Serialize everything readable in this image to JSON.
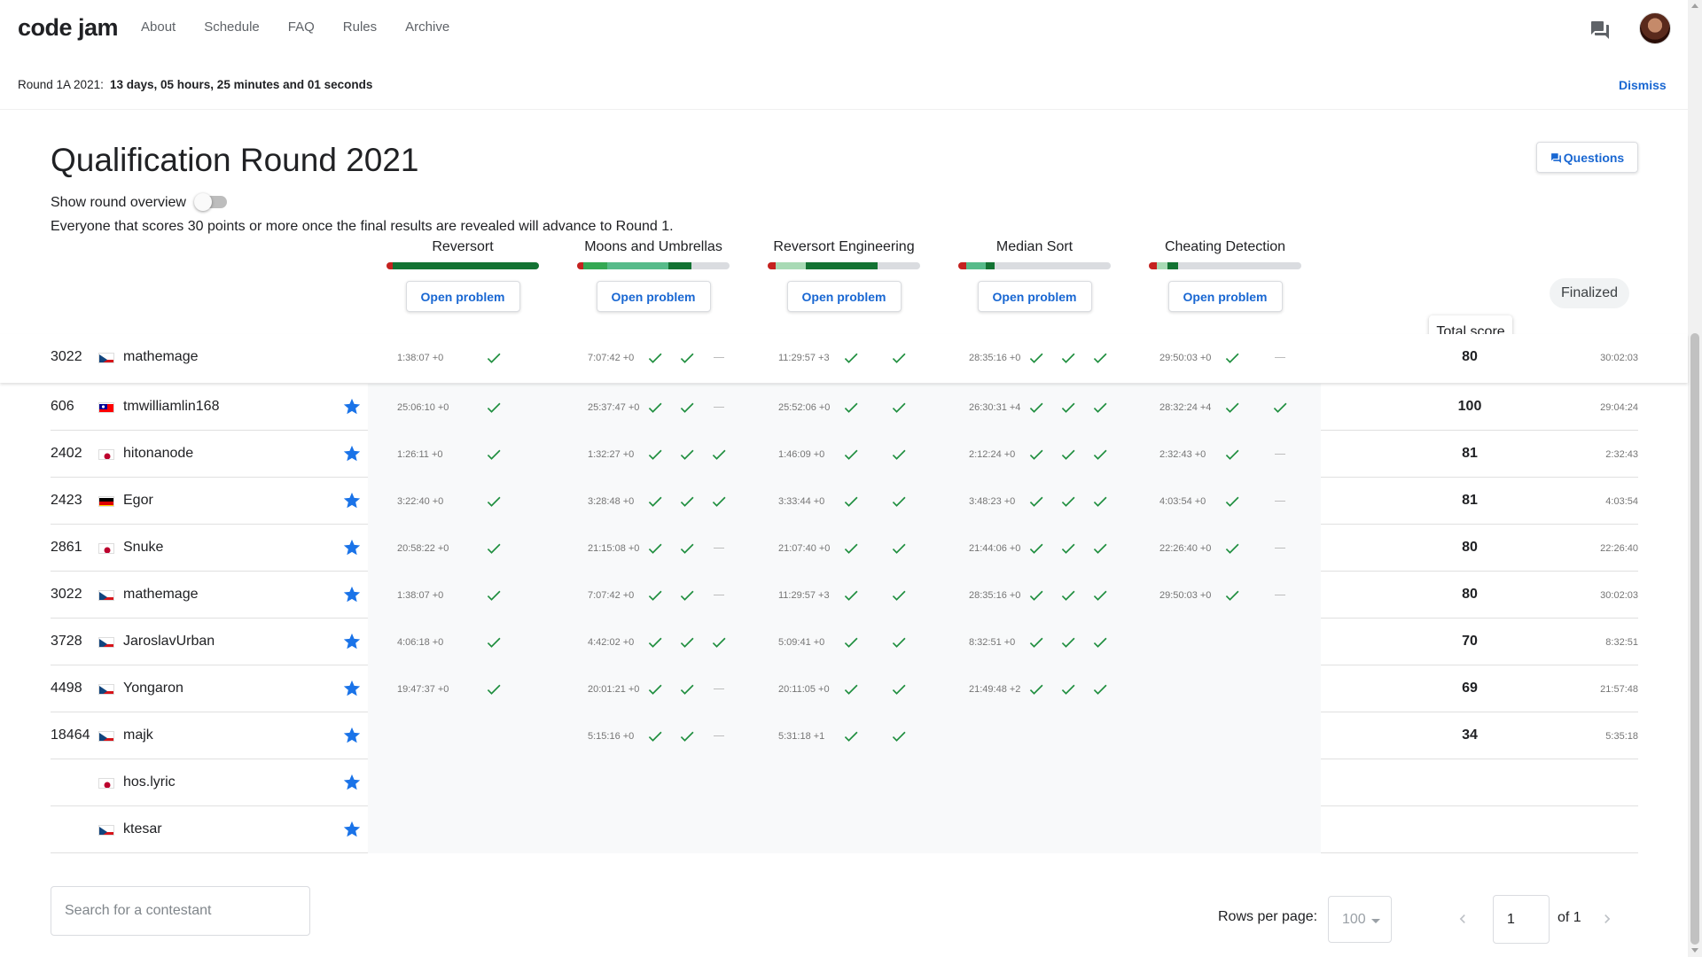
{
  "nav": {
    "logo": "code jam",
    "links": [
      "About",
      "Schedule",
      "FAQ",
      "Rules",
      "Archive"
    ]
  },
  "banner": {
    "label": "Round 1A 2021:",
    "countdown": "13 days, 05 hours, 25 minutes and 01 seconds",
    "dismiss": "Dismiss"
  },
  "page": {
    "title": "Qualification Round 2021",
    "questions_label": "Questions",
    "toggle_label": "Show round overview",
    "note": "Everyone that scores 30 points or more once the final results are revealed will advance to Round 1.",
    "finalized": "Finalized",
    "total_score_tooltip": "Total score"
  },
  "problems": [
    {
      "name": "Reversort",
      "button": "Open problem",
      "progress": [
        {
          "color": "#c5221f",
          "pct": 4
        },
        {
          "color": "#137333",
          "pct": 96
        }
      ]
    },
    {
      "name": "Moons and Umbrellas",
      "button": "Open problem",
      "progress": [
        {
          "color": "#c5221f",
          "pct": 4
        },
        {
          "color": "#34a853",
          "pct": 16
        },
        {
          "color": "#57bb8a",
          "pct": 40
        },
        {
          "color": "#137333",
          "pct": 15
        }
      ]
    },
    {
      "name": "Reversort Engineering",
      "button": "Open problem",
      "progress": [
        {
          "color": "#c5221f",
          "pct": 5
        },
        {
          "color": "#a8dab5",
          "pct": 20
        },
        {
          "color": "#137333",
          "pct": 47
        }
      ]
    },
    {
      "name": "Median Sort",
      "button": "Open problem",
      "progress": [
        {
          "color": "#c5221f",
          "pct": 5
        },
        {
          "color": "#57bb8a",
          "pct": 13
        },
        {
          "color": "#137333",
          "pct": 6
        }
      ]
    },
    {
      "name": "Cheating Detection",
      "button": "Open problem",
      "progress": [
        {
          "color": "#c5221f",
          "pct": 5
        },
        {
          "color": "#a8dab5",
          "pct": 7
        },
        {
          "color": "#137333",
          "pct": 7
        }
      ]
    }
  ],
  "sticky_row": {
    "rank": "3022",
    "flag": "cz",
    "name": "mathemage",
    "cells": [
      {
        "time": "1:38:07 +0",
        "marks": [
          "check"
        ]
      },
      {
        "time": "7:07:42 +0",
        "marks": [
          "check",
          "check",
          "dash"
        ]
      },
      {
        "time": "11:29:57 +3",
        "marks": [
          "check",
          "check"
        ]
      },
      {
        "time": "28:35:16 +0",
        "marks": [
          "check",
          "check",
          "check"
        ]
      },
      {
        "time": "29:50:03 +0",
        "marks": [
          "check",
          "dash"
        ]
      }
    ],
    "score": "80",
    "total_time": "30:02:03"
  },
  "rows": [
    {
      "rank": "606",
      "flag": "tw",
      "name": "tmwilliamlin168",
      "cells": [
        {
          "time": "25:06:10 +0",
          "marks": [
            "check"
          ]
        },
        {
          "time": "25:37:47 +0",
          "marks": [
            "check",
            "check",
            "dash"
          ]
        },
        {
          "time": "25:52:06 +0",
          "marks": [
            "check",
            "check"
          ]
        },
        {
          "time": "26:30:31 +4",
          "marks": [
            "check",
            "check",
            "check"
          ]
        },
        {
          "time": "28:32:24 +4",
          "marks": [
            "check",
            "check"
          ]
        }
      ],
      "score": "100",
      "total_time": "29:04:24"
    },
    {
      "rank": "2402",
      "flag": "jp",
      "name": "hitonanode",
      "cells": [
        {
          "time": "1:26:11 +0",
          "marks": [
            "check"
          ]
        },
        {
          "time": "1:32:27 +0",
          "marks": [
            "check",
            "check",
            "check"
          ]
        },
        {
          "time": "1:46:09 +0",
          "marks": [
            "check",
            "check"
          ]
        },
        {
          "time": "2:12:24 +0",
          "marks": [
            "check",
            "check",
            "check"
          ]
        },
        {
          "time": "2:32:43 +0",
          "marks": [
            "check",
            "dash"
          ]
        }
      ],
      "score": "81",
      "total_time": "2:32:43"
    },
    {
      "rank": "2423",
      "flag": "de",
      "name": "Egor",
      "cells": [
        {
          "time": "3:22:40 +0",
          "marks": [
            "check"
          ]
        },
        {
          "time": "3:28:48 +0",
          "marks": [
            "check",
            "check",
            "check"
          ]
        },
        {
          "time": "3:33:44 +0",
          "marks": [
            "check",
            "check"
          ]
        },
        {
          "time": "3:48:23 +0",
          "marks": [
            "check",
            "check",
            "check"
          ]
        },
        {
          "time": "4:03:54 +0",
          "marks": [
            "check",
            "dash"
          ]
        }
      ],
      "score": "81",
      "total_time": "4:03:54"
    },
    {
      "rank": "2861",
      "flag": "jp",
      "name": "Snuke",
      "cells": [
        {
          "time": "20:58:22 +0",
          "marks": [
            "check"
          ]
        },
        {
          "time": "21:15:08 +0",
          "marks": [
            "check",
            "check",
            "dash"
          ]
        },
        {
          "time": "21:07:40 +0",
          "marks": [
            "check",
            "check"
          ]
        },
        {
          "time": "21:44:06 +0",
          "marks": [
            "check",
            "check",
            "check"
          ]
        },
        {
          "time": "22:26:40 +0",
          "marks": [
            "check",
            "dash"
          ]
        }
      ],
      "score": "80",
      "total_time": "22:26:40"
    },
    {
      "rank": "3022",
      "flag": "cz",
      "name": "mathemage",
      "cells": [
        {
          "time": "1:38:07 +0",
          "marks": [
            "check"
          ]
        },
        {
          "time": "7:07:42 +0",
          "marks": [
            "check",
            "check",
            "dash"
          ]
        },
        {
          "time": "11:29:57 +3",
          "marks": [
            "check",
            "check"
          ]
        },
        {
          "time": "28:35:16 +0",
          "marks": [
            "check",
            "check",
            "check"
          ]
        },
        {
          "time": "29:50:03 +0",
          "marks": [
            "check",
            "dash"
          ]
        }
      ],
      "score": "80",
      "total_time": "30:02:03"
    },
    {
      "rank": "3728",
      "flag": "cz",
      "name": "JaroslavUrban",
      "cells": [
        {
          "time": "4:06:18 +0",
          "marks": [
            "check"
          ]
        },
        {
          "time": "4:42:02 +0",
          "marks": [
            "check",
            "check",
            "check"
          ]
        },
        {
          "time": "5:09:41 +0",
          "marks": [
            "check",
            "check"
          ]
        },
        {
          "time": "8:32:51 +0",
          "marks": [
            "check",
            "check",
            "check"
          ]
        },
        {
          "time": "",
          "marks": []
        }
      ],
      "score": "70",
      "total_time": "8:32:51"
    },
    {
      "rank": "4498",
      "flag": "cz",
      "name": "Yongaron",
      "cells": [
        {
          "time": "19:47:37 +0",
          "marks": [
            "check"
          ]
        },
        {
          "time": "20:01:21 +0",
          "marks": [
            "check",
            "check",
            "dash"
          ]
        },
        {
          "time": "20:11:05 +0",
          "marks": [
            "check",
            "check"
          ]
        },
        {
          "time": "21:49:48 +2",
          "marks": [
            "check",
            "check",
            "check"
          ]
        },
        {
          "time": "",
          "marks": []
        }
      ],
      "score": "69",
      "total_time": "21:57:48"
    },
    {
      "rank": "18464",
      "flag": "cz",
      "name": "majk",
      "cells": [
        {
          "time": "",
          "marks": []
        },
        {
          "time": "5:15:16 +0",
          "marks": [
            "check",
            "check",
            "dash"
          ]
        },
        {
          "time": "5:31:18 +1",
          "marks": [
            "check",
            "check"
          ]
        },
        {
          "time": "",
          "marks": []
        },
        {
          "time": "",
          "marks": []
        }
      ],
      "score": "34",
      "total_time": "5:35:18"
    },
    {
      "rank": "",
      "flag": "jp",
      "name": "hos.lyric",
      "cells": [
        {
          "time": "",
          "marks": []
        },
        {
          "time": "",
          "marks": []
        },
        {
          "time": "",
          "marks": []
        },
        {
          "time": "",
          "marks": []
        },
        {
          "time": "",
          "marks": []
        }
      ],
      "score": "",
      "total_time": ""
    },
    {
      "rank": "",
      "flag": "cz",
      "name": "ktesar",
      "cells": [
        {
          "time": "",
          "marks": []
        },
        {
          "time": "",
          "marks": []
        },
        {
          "time": "",
          "marks": []
        },
        {
          "time": "",
          "marks": []
        },
        {
          "time": "",
          "marks": []
        }
      ],
      "score": "",
      "total_time": ""
    }
  ],
  "footer": {
    "search_placeholder": "Search for a contestant",
    "rows_per_page_label": "Rows per page:",
    "rows_per_page_value": "100",
    "page_value": "1",
    "of_label": "of 1"
  },
  "colors": {
    "accent": "#1967d2",
    "check": "#1e8e3e",
    "star": "#1a73e8"
  }
}
